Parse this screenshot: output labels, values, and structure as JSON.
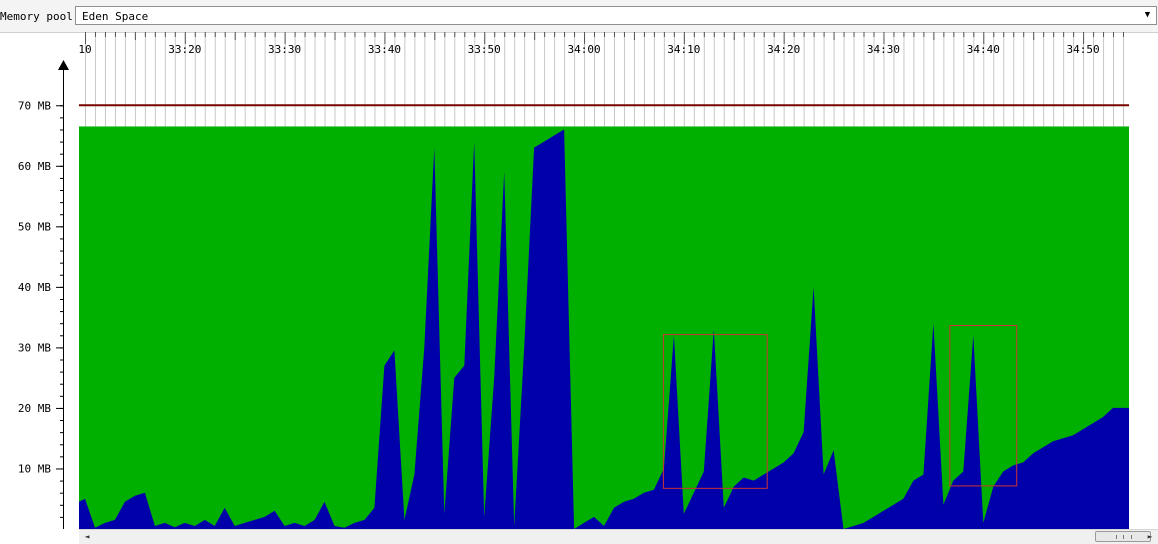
{
  "toolbar": {
    "memory_pool_label": "Memory pool:",
    "memory_pool_value": "Eden Space"
  },
  "colors": {
    "used": "#0000aa",
    "committed": "#00b000",
    "max_line": "#7a0000",
    "highlight_box": "#cc3333",
    "grid": "#c8c8c8"
  },
  "icons": {
    "dropdown": "chevron-down-icon",
    "scroll_left": "chevron-left-icon",
    "scroll_right": "chevron-right-icon"
  },
  "chart_data": {
    "type": "area",
    "xlabel": "",
    "ylabel": "",
    "grid": "vertical",
    "x_tick_labels": [
      "10",
      "33:20",
      "33:30",
      "33:40",
      "33:50",
      "34:00",
      "34:10",
      "34:20",
      "34:30",
      "34:40",
      "34:50"
    ],
    "x_tick_seconds": [
      1990,
      2000,
      2010,
      2020,
      2030,
      2040,
      2050,
      2060,
      2070,
      2080,
      2090
    ],
    "xlim_seconds": [
      1989.4,
      2094.6
    ],
    "y_tick_labels": [
      "10 MB",
      "20 MB",
      "30 MB",
      "40 MB",
      "50 MB",
      "60 MB",
      "70 MB"
    ],
    "y_tick_values": [
      10,
      20,
      30,
      40,
      50,
      60,
      70
    ],
    "ylim": [
      0,
      75
    ],
    "max_mb": 70,
    "committed_mb": 66.5,
    "series": [
      {
        "x": [
          1989.4,
          1990.0,
          1991.0,
          1992.0,
          1993.0,
          1994.0,
          1995.0,
          1996.0,
          1997.0,
          1998.0,
          1999.0,
          2000.0,
          2001.0,
          2002.0,
          2003.0,
          2004.0,
          2005.0,
          2006.0,
          2007.0,
          2008.0,
          2009.0,
          2010.0,
          2011.0,
          2012.0,
          2013.0,
          2014.0,
          2015.0,
          2016.0,
          2017.0,
          2018.0,
          2019.0,
          2020.0,
          2021.0,
          2022.0,
          2023.0,
          2024.0,
          2025.0,
          2026.0,
          2027.0,
          2028.0,
          2029.0,
          2030.0,
          2031.0,
          2032.0,
          2033.0,
          2034.0,
          2035.0,
          2036.0,
          2037.0,
          2038.0,
          2039.0,
          2040.0,
          2041.0,
          2042.0,
          2043.0,
          2044.0,
          2045.0,
          2046.0,
          2047.0,
          2048.0,
          2049.0,
          2050.0,
          2051.0,
          2052.0,
          2053.0,
          2054.0,
          2055.0,
          2056.0,
          2057.0,
          2058.0,
          2059.0,
          2060.0,
          2061.0,
          2062.0,
          2063.0,
          2064.0,
          2065.0,
          2066.0,
          2067.0,
          2068.0,
          2069.0,
          2070.0,
          2071.0,
          2072.0,
          2073.0,
          2074.0,
          2075.0,
          2076.0,
          2077.0,
          2078.0,
          2079.0,
          2080.0,
          2081.0,
          2082.0,
          2083.0,
          2084.0,
          2085.0,
          2086.0,
          2087.0,
          2088.0,
          2089.0,
          2090.0,
          2091.0,
          2092.0,
          2093.0,
          2094.0,
          2094.6
        ],
        "y": [
          4.5,
          5.0,
          0.2,
          1.0,
          1.5,
          4.5,
          5.5,
          6.0,
          0.5,
          1.0,
          0.3,
          1.0,
          0.5,
          1.5,
          0.5,
          3.5,
          0.5,
          1.0,
          1.5,
          2.0,
          3.0,
          0.5,
          1.0,
          0.5,
          1.5,
          4.5,
          0.5,
          0.2,
          1.0,
          1.5,
          3.5,
          27.0,
          29.5,
          1.5,
          9.0,
          30.0,
          63.0,
          2.5,
          25.0,
          27.0,
          64.0,
          2.0,
          25.0,
          59.0,
          0.5,
          30.0,
          63.0,
          64.0,
          65.0,
          66.0,
          0.0,
          1.0,
          2.0,
          0.5,
          3.5,
          4.5,
          5.0,
          6.0,
          6.5,
          10.0,
          32.0,
          2.5,
          6.0,
          9.5,
          33.0,
          3.5,
          7.0,
          8.5,
          8.0,
          9.0,
          10.0,
          11.0,
          12.5,
          16.0,
          40.0,
          9.0,
          13.0,
          0.0,
          0.5,
          1.0,
          2.0,
          3.0,
          4.0,
          5.0,
          8.0,
          9.0,
          34.0,
          4.0,
          8.0,
          9.5,
          32.0,
          1.0,
          7.0,
          9.5,
          10.5,
          11.0,
          12.5,
          13.5,
          14.5,
          15.0,
          15.5,
          16.5,
          17.5,
          18.5,
          20.0,
          20.0,
          20.0
        ]
      }
    ],
    "annotations": [
      {
        "type": "box",
        "x_range": [
          2047.9,
          2058.3
        ],
        "y_range": [
          6.8,
          32.2
        ]
      },
      {
        "type": "box",
        "x_range": [
          2076.6,
          2083.3
        ],
        "y_range": [
          7.2,
          33.7
        ]
      }
    ]
  }
}
